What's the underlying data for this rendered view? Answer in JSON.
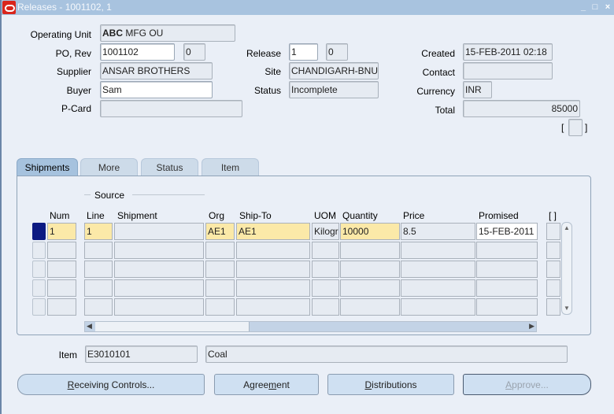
{
  "window": {
    "title": "Releases - 1001102, 1",
    "controls": {
      "minimize": "_",
      "maximize": "□",
      "close": "×"
    }
  },
  "header": {
    "operating_unit": {
      "label": "Operating Unit",
      "value_bold": "ABC",
      "value_rest": " MFG OU"
    },
    "po_rev": {
      "label": "PO, Rev",
      "po": "1001102",
      "rev": "0"
    },
    "supplier": {
      "label": "Supplier",
      "value": "ANSAR BROTHERS"
    },
    "buyer": {
      "label": "Buyer",
      "value": "Sam"
    },
    "pcard": {
      "label": "P-Card",
      "value": ""
    },
    "release": {
      "label": "Release",
      "num": "1",
      "rev": "0"
    },
    "site": {
      "label": "Site",
      "value": "CHANDIGARH-BNU"
    },
    "status": {
      "label": "Status",
      "value": "Incomplete"
    },
    "created": {
      "label": "Created",
      "value": "15-FEB-2011 02:18"
    },
    "contact": {
      "label": "Contact",
      "value": ""
    },
    "currency": {
      "label": "Currency",
      "value": "INR"
    },
    "total": {
      "label": "Total",
      "value": "85000"
    },
    "flex_bracket": {
      "open": "[",
      "close": "]"
    }
  },
  "tabs": [
    {
      "label": "Shipments",
      "active": true
    },
    {
      "label": "More",
      "active": false
    },
    {
      "label": "Status",
      "active": false
    },
    {
      "label": "Item",
      "active": false
    }
  ],
  "shipments": {
    "group_label": "Source",
    "columns": [
      "Num",
      "Line",
      "Shipment",
      "Org",
      "Ship-To",
      "UOM",
      "Quantity",
      "Price",
      "Promised",
      "[ ]"
    ],
    "rows": [
      {
        "num": "1",
        "line": "1",
        "shipment": "",
        "org": "AE1",
        "ship_to": "AE1",
        "uom": "Kilogram",
        "quantity": "10000",
        "price": "8.5",
        "promised": "15-FEB-2011"
      },
      {
        "num": "",
        "line": "",
        "shipment": "",
        "org": "",
        "ship_to": "",
        "uom": "",
        "quantity": "",
        "price": "",
        "promised": ""
      },
      {
        "num": "",
        "line": "",
        "shipment": "",
        "org": "",
        "ship_to": "",
        "uom": "",
        "quantity": "",
        "price": "",
        "promised": ""
      },
      {
        "num": "",
        "line": "",
        "shipment": "",
        "org": "",
        "ship_to": "",
        "uom": "",
        "quantity": "",
        "price": "",
        "promised": ""
      },
      {
        "num": "",
        "line": "",
        "shipment": "",
        "org": "",
        "ship_to": "",
        "uom": "",
        "quantity": "",
        "price": "",
        "promised": ""
      }
    ]
  },
  "item": {
    "label": "Item",
    "code": "E3010101",
    "description": "Coal"
  },
  "buttons": {
    "receiving_controls": {
      "mnemonic": "R",
      "rest": "eceiving Controls..."
    },
    "agreement": {
      "pre": "Agree",
      "mnemonic": "m",
      "rest": "ent"
    },
    "distributions": {
      "mnemonic": "D",
      "rest": "istributions"
    },
    "approve": {
      "mnemonic": "A",
      "rest": "pprove..."
    }
  }
}
